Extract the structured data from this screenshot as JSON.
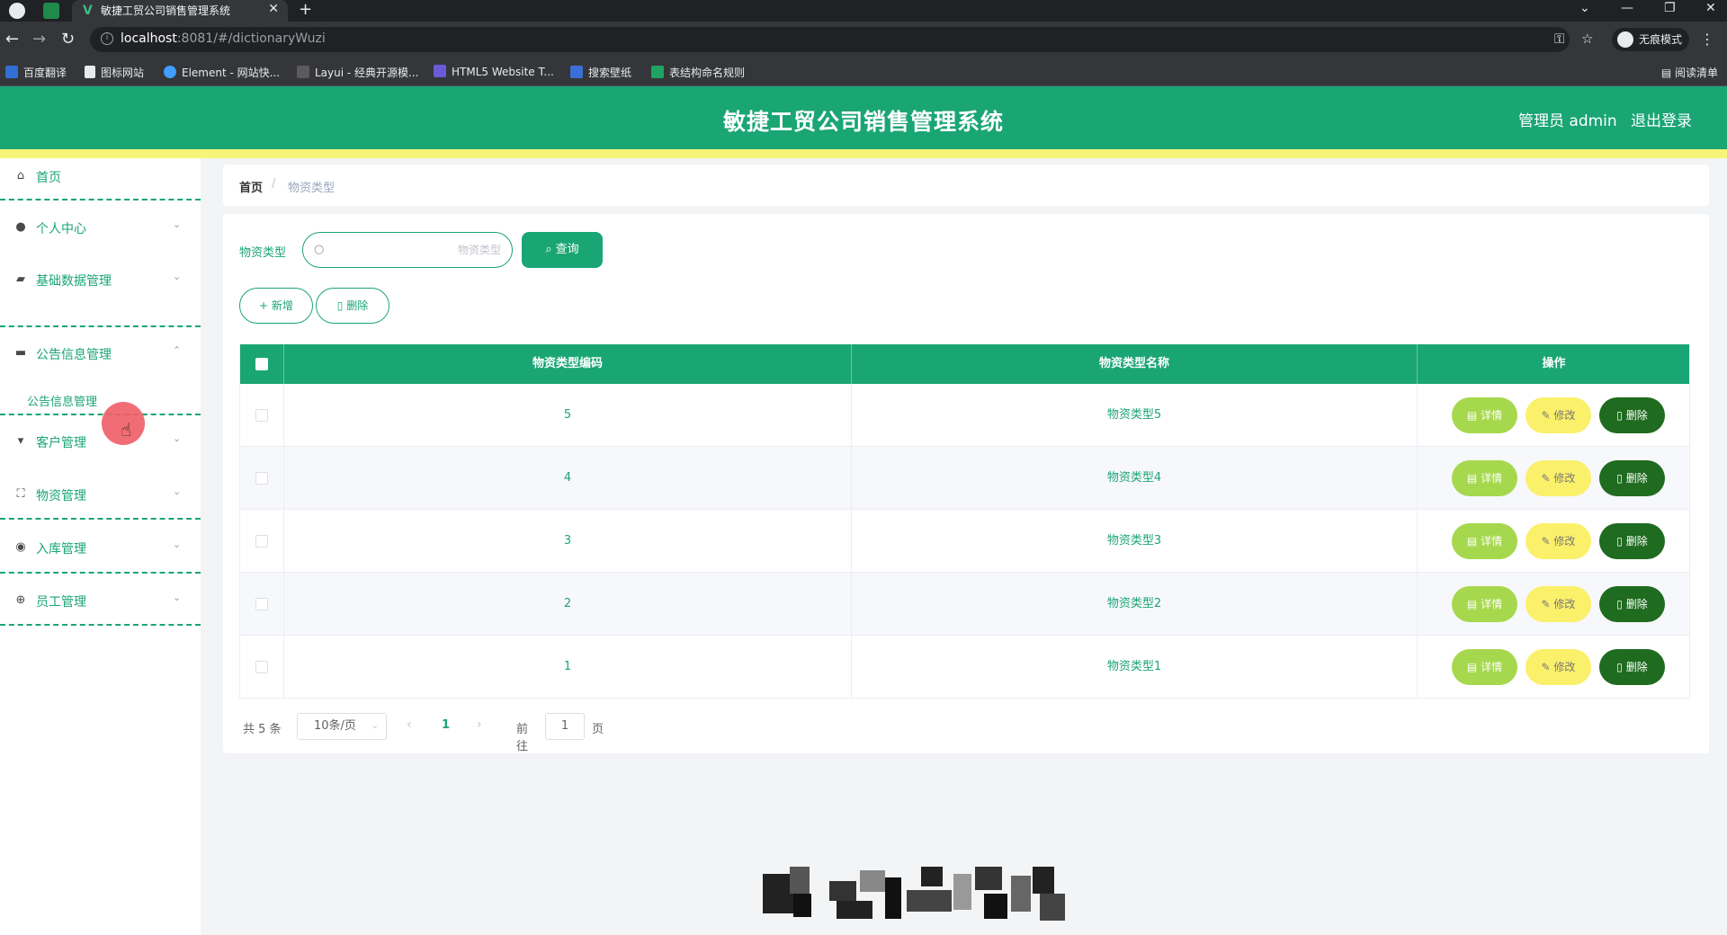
{
  "browser": {
    "tab_title": "敏捷工贸公司销售管理系统",
    "url_host": "localhost",
    "url_rest": ":8081/#/dictionaryWuzi",
    "incognito_label": "无痕模式",
    "reading_list": "阅读清单",
    "bookmarks": [
      "百度翻译",
      "图标网站",
      "Element - 网站快...",
      "Layui - 经典开源模...",
      "HTML5 Website T...",
      "搜索壁纸",
      "表结构命名规则"
    ]
  },
  "header": {
    "title": "敏捷工贸公司销售管理系统",
    "user": "管理员 admin",
    "logout": "退出登录"
  },
  "sidebar": {
    "items": [
      {
        "label": "首页",
        "icon": "home-icon"
      },
      {
        "label": "个人中心",
        "icon": "user-icon"
      },
      {
        "label": "基础数据管理",
        "icon": "data-icon"
      },
      {
        "label": "公告信息管理",
        "icon": "notice-icon"
      },
      {
        "label": "客户管理",
        "icon": "customer-icon"
      },
      {
        "label": "物资管理",
        "icon": "material-icon"
      },
      {
        "label": "入库管理",
        "icon": "inbound-icon"
      },
      {
        "label": "员工管理",
        "icon": "staff-icon"
      }
    ],
    "sub_item": "公告信息管理"
  },
  "breadcrumb": {
    "home": "首页",
    "separator": "/",
    "current": "物资类型"
  },
  "filter": {
    "label": "物资类型",
    "placeholder": "物资类型",
    "query_button": "查询"
  },
  "toolbar": {
    "add_label": "新增",
    "delete_label": "删除"
  },
  "table": {
    "headers": [
      "物资类型编码",
      "物资类型名称",
      "操作"
    ],
    "rows": [
      {
        "code": "5",
        "name": "物资类型5"
      },
      {
        "code": "4",
        "name": "物资类型4"
      },
      {
        "code": "3",
        "name": "物资类型3"
      },
      {
        "code": "2",
        "name": "物资类型2"
      },
      {
        "code": "1",
        "name": "物资类型1"
      }
    ],
    "actions": {
      "detail": "详情",
      "edit": "修改",
      "delete": "删除"
    }
  },
  "pagination": {
    "total": "共 5 条",
    "page_size": "10条/页",
    "current_page": "1",
    "goto_prefix": "前往",
    "goto_value": "1",
    "goto_suffix": "页"
  },
  "colors": {
    "primary": "#1aa574",
    "accent_bar": "#f6f57a",
    "detail_button": "#a6d84d",
    "edit_button": "#fbf06a",
    "delete_button": "#1f6b1f"
  }
}
